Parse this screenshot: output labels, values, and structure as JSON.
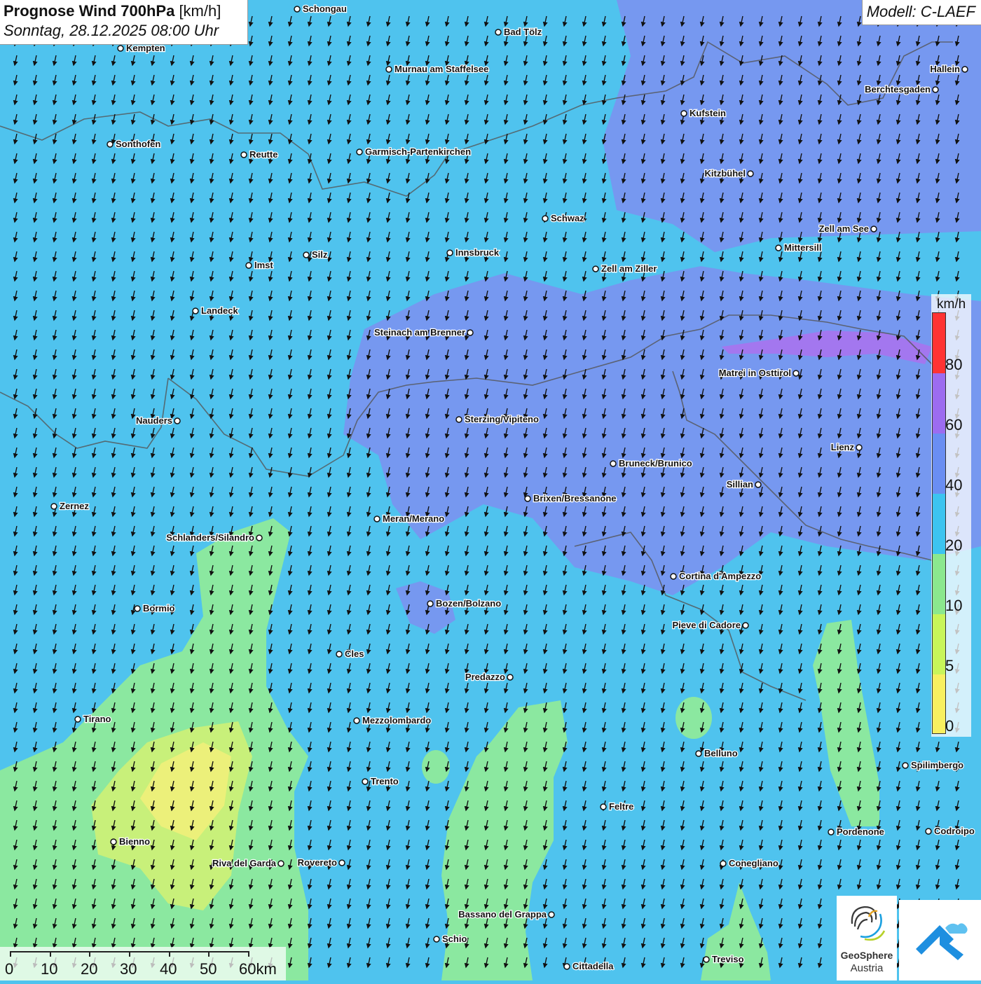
{
  "header": {
    "title_bold": "Prognose Wind 700hPa",
    "title_unit": "[km/h]",
    "datetime": "Sonntag, 28.12.2025 08:00 Uhr",
    "model": "Modell: C-LAEF"
  },
  "legend": {
    "unit": "km/h",
    "ticks": [
      "80",
      "60",
      "40",
      "20",
      "10",
      "5",
      "0"
    ],
    "colors": [
      "#ff3333",
      "#9c6cf0",
      "#6a8ef2",
      "#3cc4f0",
      "#8be88e",
      "#c8f55a",
      "#f8f060"
    ]
  },
  "scalebar": {
    "labels": [
      "0",
      "10",
      "20",
      "30",
      "40",
      "50",
      "60km"
    ]
  },
  "cities": [
    {
      "name": "Schongau"
    },
    {
      "name": "Kempten"
    },
    {
      "name": "Bad Tölz"
    },
    {
      "name": "Murnau am Staffelsee"
    },
    {
      "name": "Hallein"
    },
    {
      "name": "Berchtesgaden"
    },
    {
      "name": "Kufstein"
    },
    {
      "name": "Sonthofen"
    },
    {
      "name": "Reutte"
    },
    {
      "name": "Garmisch-Partenkirchen"
    },
    {
      "name": "Kitzbühel"
    },
    {
      "name": "Schwaz"
    },
    {
      "name": "Zell am See"
    },
    {
      "name": "Mittersill"
    },
    {
      "name": "Silz"
    },
    {
      "name": "Innsbruck"
    },
    {
      "name": "Imst"
    },
    {
      "name": "Zell am Ziller"
    },
    {
      "name": "Landeck"
    },
    {
      "name": "Steinach am Brenner"
    },
    {
      "name": "Matrei in Osttirol"
    },
    {
      "name": "Nauders"
    },
    {
      "name": "Sterzing/Vipiteno"
    },
    {
      "name": "Lienz"
    },
    {
      "name": "Bruneck/Brunico"
    },
    {
      "name": "Sillian"
    },
    {
      "name": "Zernez"
    },
    {
      "name": "Brixen/Bressanone"
    },
    {
      "name": "Meran/Merano"
    },
    {
      "name": "Schlanders/Silandro"
    },
    {
      "name": "Cortina d'Ampezzo"
    },
    {
      "name": "Bormio"
    },
    {
      "name": "Bozen/Bolzano"
    },
    {
      "name": "Pieve di Cadore"
    },
    {
      "name": "Cles"
    },
    {
      "name": "Predazzo"
    },
    {
      "name": "Tirano"
    },
    {
      "name": "Mezzolombardo"
    },
    {
      "name": "Belluno"
    },
    {
      "name": "Spilimbergo"
    },
    {
      "name": "Trento"
    },
    {
      "name": "Feltre"
    },
    {
      "name": "Bienno"
    },
    {
      "name": "Pordenone"
    },
    {
      "name": "Codroipo"
    },
    {
      "name": "Riva del Garda"
    },
    {
      "name": "Rovereto"
    },
    {
      "name": "Conegliano"
    },
    {
      "name": "Bassano del Grappa"
    },
    {
      "name": "Schio"
    },
    {
      "name": "Treviso"
    },
    {
      "name": "Cittadella"
    }
  ],
  "logos": {
    "geosphere_name": "GeoSphere",
    "geosphere_sub": "Austria"
  },
  "wind": {
    "direction": "from north-northeast (arrows pointing south-southwest)"
  }
}
